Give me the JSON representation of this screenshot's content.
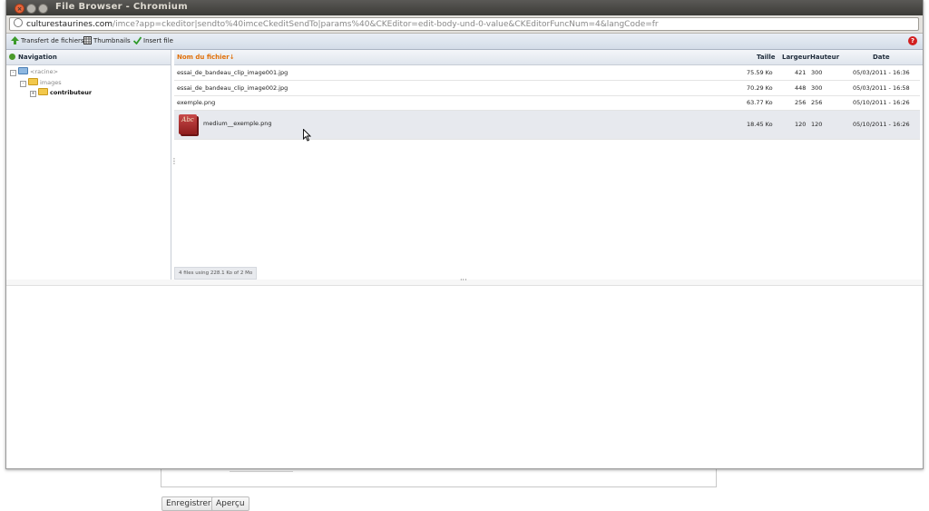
{
  "window": {
    "title": "File Browser - Chromium",
    "url_domain": "culturestaurines.com",
    "url_rest": "/imce?app=ckeditor|sendto%40imceCkeditSendTo|params%40&CKEditor=edit-body-und-0-value&CKEditorFuncNum=4&langCode=fr"
  },
  "toolbar": {
    "upload_label": "Transfert de fichiers",
    "thumbnails_label": "Thumbnails",
    "insert_label": "Insert file"
  },
  "navigation": {
    "title": "Navigation",
    "tree": [
      {
        "label": "<racine>",
        "toggle": "-",
        "folder": "blue"
      },
      {
        "label": "images",
        "toggle": "-",
        "folder": "yellow"
      },
      {
        "label": "contributeur",
        "toggle": "+",
        "folder": "yellow",
        "selected": true
      }
    ]
  },
  "files": {
    "columns": {
      "name": "Nom du fichier↓",
      "size": "Taille",
      "width": "Largeur",
      "height": "Hauteur",
      "date": "Date"
    },
    "rows": [
      {
        "name": "essai_de_bandeau_clip_image001.jpg",
        "size": "75.59 Ko",
        "width": "421",
        "height": "300",
        "date": "05/03/2011 - 16:36"
      },
      {
        "name": "essai_de_bandeau_clip_image002.jpg",
        "size": "70.29 Ko",
        "width": "448",
        "height": "300",
        "date": "05/03/2011 - 16:58"
      },
      {
        "name": "exemple.png",
        "size": "63.77 Ko",
        "width": "256",
        "height": "256",
        "date": "05/10/2011 - 16:26"
      },
      {
        "name": "medium__exemple.png",
        "size": "18.45 Ko",
        "width": "120",
        "height": "120",
        "date": "05/10/2011 - 16:26",
        "selected": true,
        "thumb_text": "Abc"
      }
    ],
    "status": "4 files using 228.1 Ko of 2 Mo"
  },
  "background_form": {
    "save_label": "Enregistrer",
    "preview_label": "Aperçu"
  }
}
